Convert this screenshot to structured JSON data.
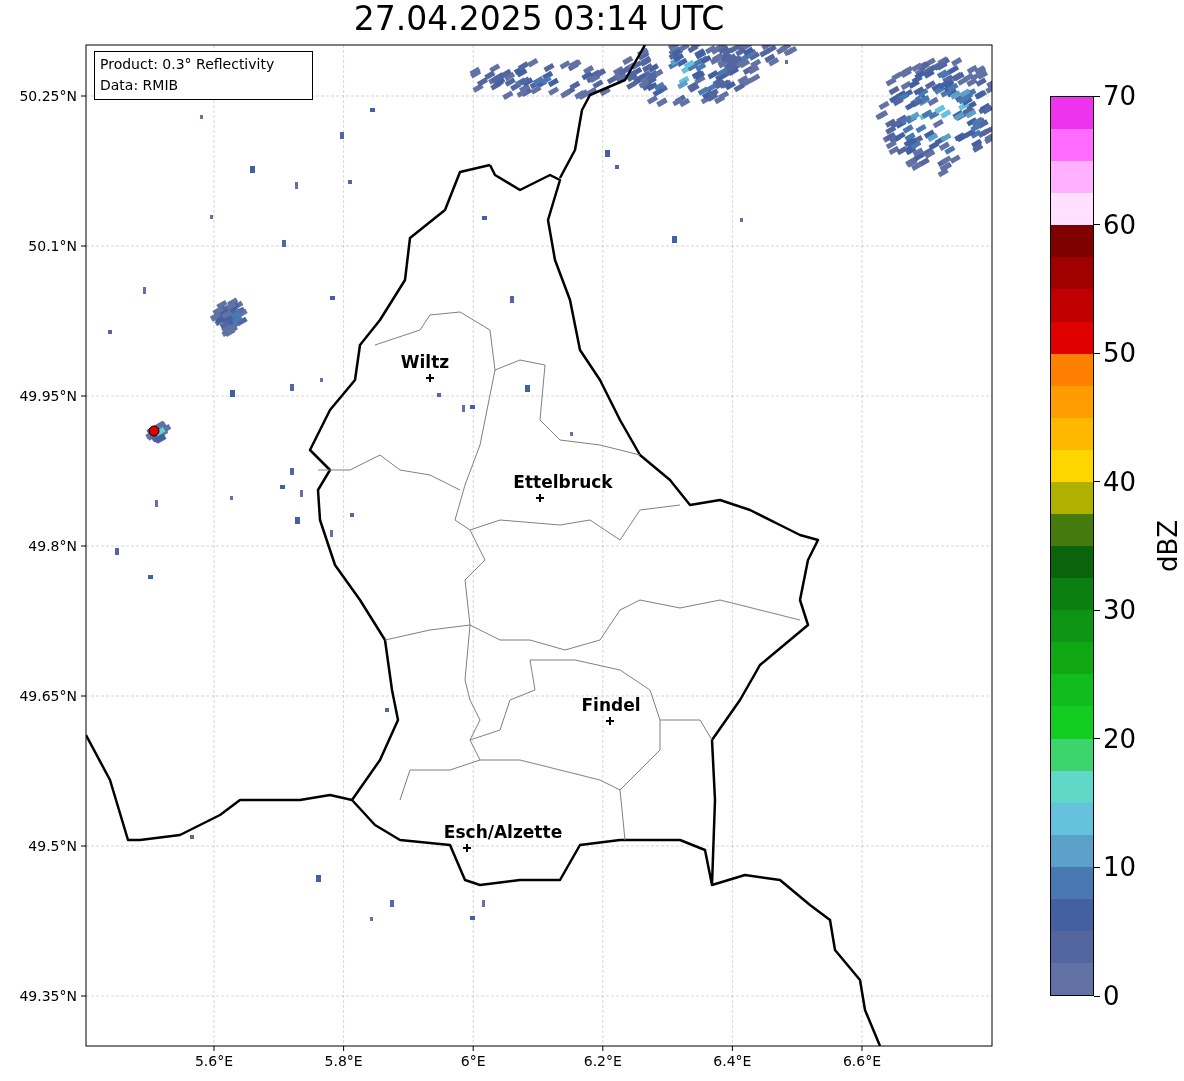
{
  "title": "27.04.2025 03:14 UTC",
  "info_box": [
    "Product: 0.3° Reflectivity",
    "Data: RMIB"
  ],
  "map": {
    "lat_labels": [
      "50.25°N",
      "50.1°N",
      "49.95°N",
      "49.8°N",
      "49.65°N",
      "49.5°N",
      "49.35°N"
    ],
    "lon_labels": [
      "5.6°E",
      "5.8°E",
      "6°E",
      "6.2°E",
      "6.4°E",
      "6.6°E"
    ],
    "cities": [
      {
        "name": "Wiltz"
      },
      {
        "name": "Ettelbruck"
      },
      {
        "name": "Findel"
      },
      {
        "name": "Esch/Alzette"
      }
    ]
  },
  "colorbar": {
    "label": "dBZ",
    "ticks": [
      "70",
      "60",
      "50",
      "40",
      "30",
      "20",
      "10",
      "0"
    ],
    "bands": [
      {
        "color": "#ee33ee"
      },
      {
        "color": "#ff6cff"
      },
      {
        "color": "#ffb0ff"
      },
      {
        "color": "#ffe0ff"
      },
      {
        "color": "#800000"
      },
      {
        "color": "#a00000"
      },
      {
        "color": "#c00000"
      },
      {
        "color": "#e00000"
      },
      {
        "color": "#ff7f00"
      },
      {
        "color": "#ff9c00"
      },
      {
        "color": "#ffb800"
      },
      {
        "color": "#ffd500"
      },
      {
        "color": "#b0b000"
      },
      {
        "color": "#457a0e"
      },
      {
        "color": "#0a640c"
      },
      {
        "color": "#0c7e12"
      },
      {
        "color": "#0e9414"
      },
      {
        "color": "#0fa814"
      },
      {
        "color": "#10bc1e"
      },
      {
        "color": "#12cc20"
      },
      {
        "color": "#3cd46c"
      },
      {
        "color": "#60d8c8"
      },
      {
        "color": "#66c2dc"
      },
      {
        "color": "#5aa0c8"
      },
      {
        "color": "#4a78b2"
      },
      {
        "color": "#4360a2"
      },
      {
        "color": "#5466a0"
      },
      {
        "color": "#6272a4"
      }
    ]
  }
}
